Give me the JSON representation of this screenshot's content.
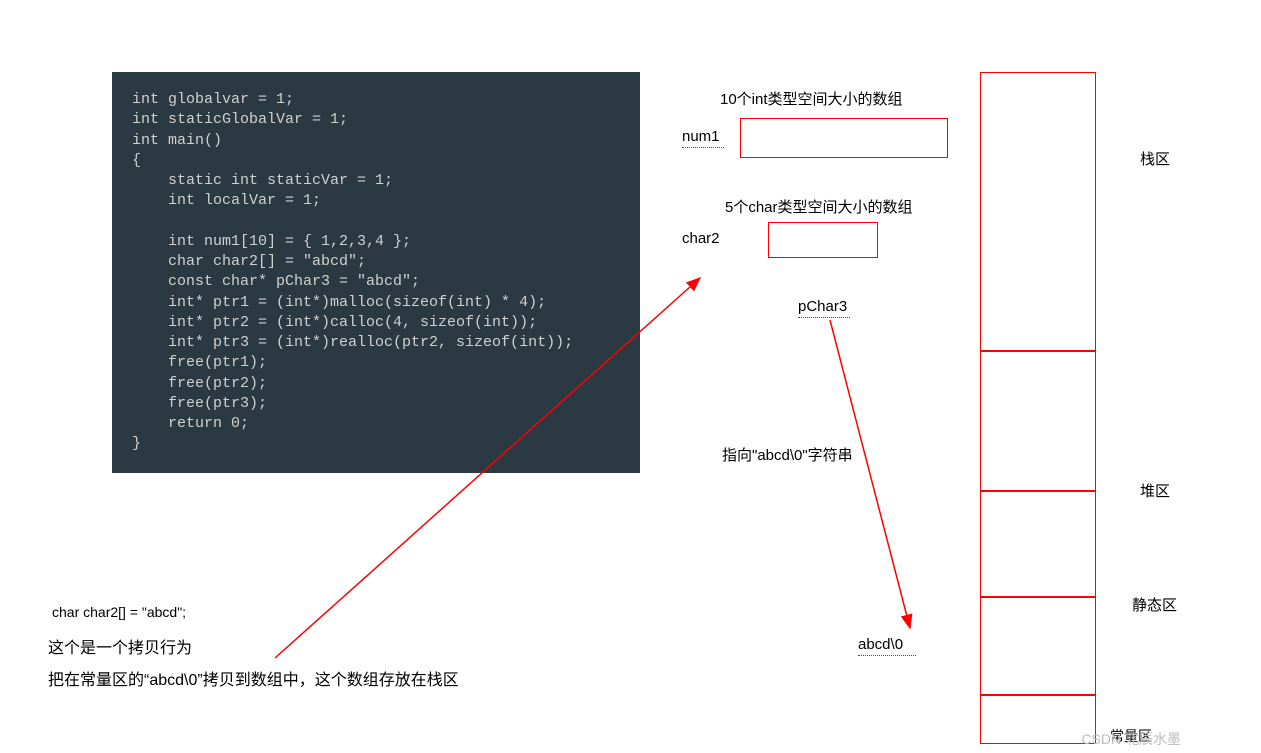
{
  "code_lines": "int globalvar = 1;\nint staticGlobalVar = 1;\nint main()\n{\n    static int staticVar = 1;\n    int localVar = 1;\n\n    int num1[10] = { 1,2,3,4 };\n    char char2[] = \"abcd\";\n    const char* pChar3 = \"abcd\";\n    int* ptr1 = (int*)malloc(sizeof(int) * 4);\n    int* ptr2 = (int*)calloc(4, sizeof(int));\n    int* ptr3 = (int*)realloc(ptr2, sizeof(int));\n    free(ptr1);\n    free(ptr2);\n    free(ptr3);\n    return 0;\n}",
  "labels": {
    "stack": "栈区",
    "heap": "堆区",
    "static": "静态区",
    "const": "常量区",
    "int_array": "10个int类型空间大小的数组",
    "num1": "num1",
    "char_array": "5个char类型空间大小的数组",
    "char2": "char2",
    "pchar3": "pChar3",
    "points_to": "指向\"abcd\\0\"字符串",
    "abcd0": "abcd\\0",
    "bottom_code": "char char2[] = \"abcd\";",
    "bottom_line1": "这个是一个拷贝行为",
    "bottom_line2": "把在常量区的“abcd\\0”拷贝到数组中，这个数组存放在栈区",
    "watermark": "CSDN 北辰水墨"
  }
}
